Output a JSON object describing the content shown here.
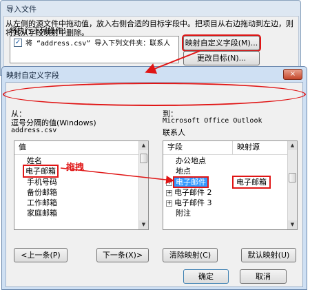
{
  "bg_dialog": {
    "title": "导入文件",
    "section_label": "将执行下列操作：",
    "action_item": "将 “address.csv” 导入下列文件夹：联系人",
    "map_button": "映射自定义字段(M)...",
    "change_button": "更改目标(N)..."
  },
  "dialog": {
    "title": "映射自定义字段",
    "close_glyph": "×",
    "instruction": "从左侧的源文件中拖动值，放入右侧合适的目标字段中。把项目从右边拖动到左边，则将其从字段映射中删除。",
    "from_label": "从：",
    "from_type": "逗号分隔的值(Windows)",
    "from_file": "address.csv",
    "to_label": "到：",
    "to_app": "Microsoft Office Outlook",
    "to_folder": "联系人",
    "left_header": "值",
    "left_items": [
      "姓名",
      "电子邮箱",
      "手机号码",
      "备份邮箱",
      "工作邮箱",
      "家庭邮箱"
    ],
    "right_header_field": "字段",
    "right_header_source": "映射源",
    "right_items": [
      {
        "label": "办公地点",
        "expand": ""
      },
      {
        "label": "地点",
        "expand": ""
      },
      {
        "label": "电子邮件",
        "expand": "⊞"
      },
      {
        "label": "电子邮件 2",
        "expand": "⊞"
      },
      {
        "label": "电子邮件 3",
        "expand": "⊞"
      },
      {
        "label": "附注",
        "expand": ""
      }
    ],
    "mapped_source": "电子邮箱",
    "drag_annotation": "拖拽",
    "prev_button": "<上一条(P)",
    "next_button": "下一条(X)>",
    "clear_button": "清除映射(C)",
    "default_button": "默认映射(U)",
    "ok_button": "确定",
    "cancel_button": "取消"
  },
  "colors": {
    "annotation_red": "#e01515",
    "selection_blue": "#3399ff"
  }
}
